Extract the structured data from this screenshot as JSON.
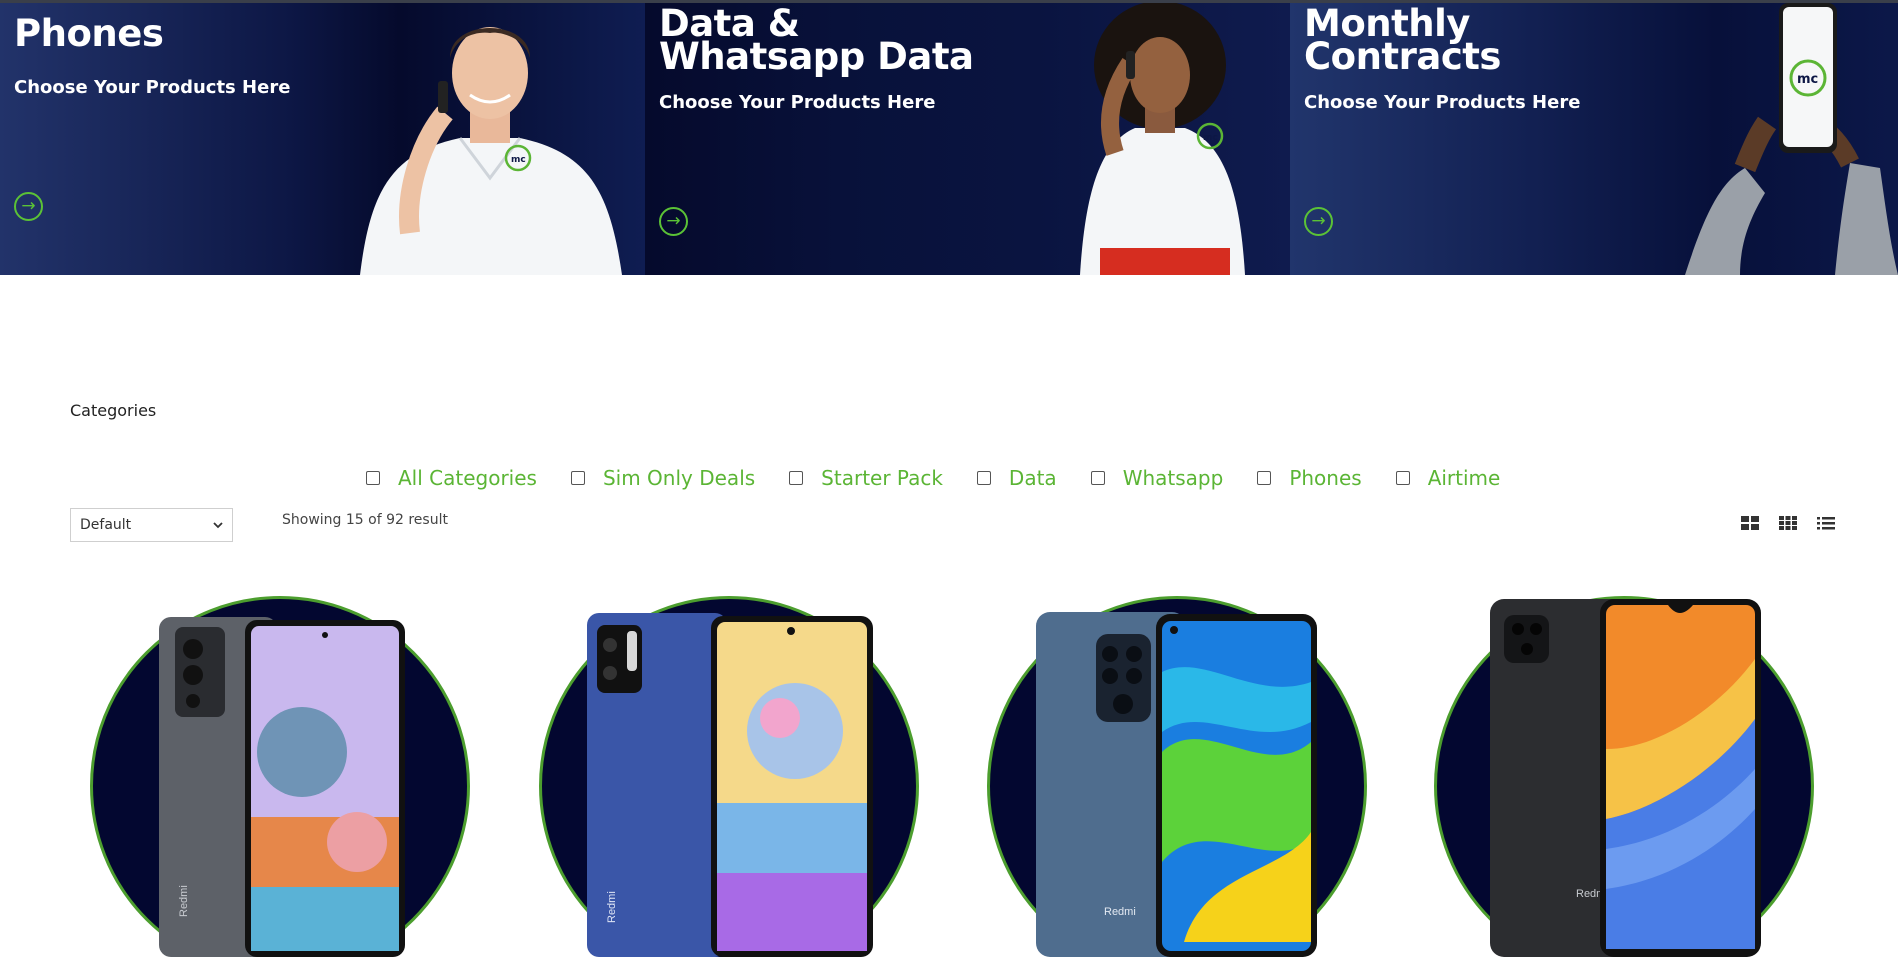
{
  "banner": {
    "panels": [
      {
        "title": "Phones",
        "subtitle": "Choose Your Products Here",
        "arrow": "→"
      },
      {
        "title": "Data &\nWhatsapp Data",
        "subtitle": "Choose Your Products Here",
        "arrow": "→"
      },
      {
        "title": "Monthly\nContracts",
        "subtitle": "Choose Your Products Here",
        "arrow": "→"
      }
    ],
    "logo_text": "mc"
  },
  "filters": {
    "heading": "Categories",
    "items": [
      {
        "label": "All Categories",
        "checked": false
      },
      {
        "label": "Sim Only Deals",
        "checked": false
      },
      {
        "label": "Starter Pack",
        "checked": false
      },
      {
        "label": "Data",
        "checked": false
      },
      {
        "label": "Whatsapp",
        "checked": false
      },
      {
        "label": "Phones",
        "checked": false
      },
      {
        "label": "Airtime",
        "checked": false
      }
    ]
  },
  "toolbar": {
    "sort_value": "Default",
    "result_text": "Showing 15 of 92 result",
    "view_icons": [
      "grid-large-icon",
      "grid-small-icon",
      "list-view-icon"
    ]
  },
  "products": [
    {
      "brand_mark": "Redmi",
      "image": "redmi-note-10-pro-gray"
    },
    {
      "brand_mark": "Redmi",
      "image": "redmi-note-10-5g-blue"
    },
    {
      "brand_mark": "Redmi",
      "image": "redmi-note-9-gray"
    },
    {
      "brand_mark": "Redmi",
      "image": "redmi-9c-black"
    }
  ],
  "colors": {
    "brand_navy": "#050a2c",
    "brand_green": "#5bb535",
    "circle_border": "#4c9e2e"
  }
}
